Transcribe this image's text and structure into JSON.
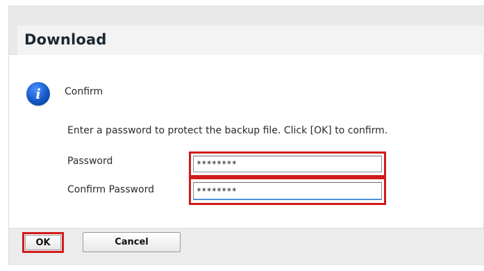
{
  "dialog": {
    "title": "Download",
    "message_title": "Confirm",
    "message_icon": "info-icon",
    "instruction": "Enter a password to protect the backup file. Click [OK] to confirm."
  },
  "form": {
    "password_label": "Password",
    "password_value": "********",
    "confirm_password_label": "Confirm Password",
    "confirm_password_value": "********"
  },
  "buttons": {
    "ok_label": "OK",
    "cancel_label": "Cancel"
  },
  "colors": {
    "highlight": "#d11a1a",
    "icon_blue": "#1557c7",
    "header_bg": "#e9e9e9"
  }
}
